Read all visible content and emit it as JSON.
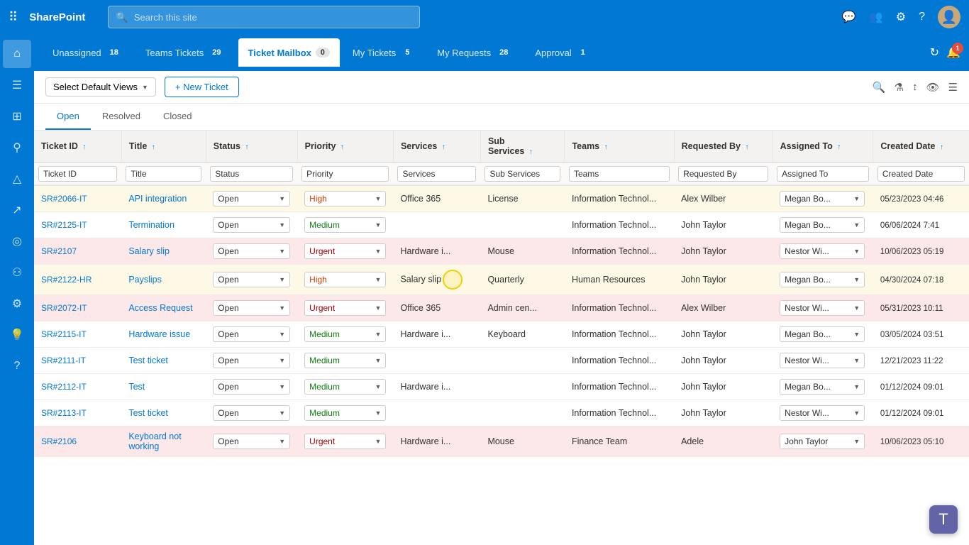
{
  "app": {
    "name": "SharePoint"
  },
  "search": {
    "placeholder": "Search this site"
  },
  "tabs": [
    {
      "id": "unassigned",
      "label": "Unassigned",
      "count": "18",
      "active": false
    },
    {
      "id": "teams-tickets",
      "label": "Teams Tickets",
      "count": "29",
      "active": false
    },
    {
      "id": "ticket-mailbox",
      "label": "Ticket Mailbox",
      "count": "0",
      "active": true
    },
    {
      "id": "my-tickets",
      "label": "My Tickets",
      "count": "5",
      "active": false
    },
    {
      "id": "my-requests",
      "label": "My Requests",
      "count": "28",
      "active": false
    },
    {
      "id": "approval",
      "label": "Approval",
      "count": "1",
      "active": false
    }
  ],
  "notification_count": "1",
  "toolbar": {
    "view_label": "Select Default Views",
    "new_ticket_label": "+ New Ticket"
  },
  "status_tabs": [
    {
      "label": "Open",
      "active": true
    },
    {
      "label": "Resolved",
      "active": false
    },
    {
      "label": "Closed",
      "active": false
    }
  ],
  "columns": [
    {
      "id": "ticket-id",
      "label": "Ticket ID",
      "sort": "↑"
    },
    {
      "id": "title",
      "label": "Title",
      "sort": "↑"
    },
    {
      "id": "status",
      "label": "Status",
      "sort": "↑"
    },
    {
      "id": "priority",
      "label": "Priority",
      "sort": "↑"
    },
    {
      "id": "services",
      "label": "Services",
      "sort": "↑"
    },
    {
      "id": "sub-services",
      "label": "Sub Services",
      "sort": "↑"
    },
    {
      "id": "teams",
      "label": "Teams",
      "sort": "↑"
    },
    {
      "id": "requested-by",
      "label": "Requested By",
      "sort": "↑"
    },
    {
      "id": "assigned-to",
      "label": "Assigned To",
      "sort": "↑"
    },
    {
      "id": "created-date",
      "label": "Created Date",
      "sort": "↑"
    }
  ],
  "filter_row": {
    "ticket_id": "Ticket ID",
    "title": "Title",
    "status": "Status",
    "priority": "Priority",
    "services": "Services",
    "sub_services": "Sub Services",
    "teams": "Teams",
    "requested_by": "Requested By",
    "assigned_to": "Assigned To",
    "created_date": "Created Date"
  },
  "rows": [
    {
      "id": "SR#2066-IT",
      "title": "API integration",
      "status": "Open",
      "priority": "High",
      "services": "Office 365",
      "sub_services": "License",
      "teams": "Information Technol...",
      "requested_by": "Alex Wilber",
      "assigned_to": "Megan Bo...",
      "created_date": "05/23/2023 04:46",
      "row_class": "row-yellow"
    },
    {
      "id": "SR#2125-IT",
      "title": "Termination",
      "status": "Open",
      "priority": "Medium",
      "services": "",
      "sub_services": "",
      "teams": "Information Technol...",
      "requested_by": "John Taylor",
      "assigned_to": "Megan Bo...",
      "created_date": "06/06/2024 7:41",
      "row_class": "row-white"
    },
    {
      "id": "SR#2107",
      "title": "Salary slip",
      "status": "Open",
      "priority": "Urgent",
      "services": "Hardware i...",
      "sub_services": "Mouse",
      "teams": "Information Technol...",
      "requested_by": "John Taylor",
      "assigned_to": "Nestor Wi...",
      "created_date": "10/06/2023 05:19",
      "row_class": "row-pink"
    },
    {
      "id": "SR#2122-HR",
      "title": "Payslips",
      "status": "Open",
      "priority": "High",
      "services": "Salary slip",
      "sub_services": "Quarterly",
      "teams": "Human Resources",
      "requested_by": "John Taylor",
      "assigned_to": "Megan Bo...",
      "created_date": "04/30/2024 07:18",
      "row_class": "row-yellow",
      "cursor": true
    },
    {
      "id": "SR#2072-IT",
      "title": "Access Request",
      "status": "Open",
      "priority": "Urgent",
      "services": "Office 365",
      "sub_services": "Admin cen...",
      "teams": "Information Technol...",
      "requested_by": "Alex Wilber",
      "assigned_to": "Nestor Wi...",
      "created_date": "05/31/2023 10:11",
      "row_class": "row-pink"
    },
    {
      "id": "SR#2115-IT",
      "title": "Hardware issue",
      "status": "Open",
      "priority": "Medium",
      "services": "Hardware i...",
      "sub_services": "Keyboard",
      "teams": "Information Technol...",
      "requested_by": "John Taylor",
      "assigned_to": "Megan Bo...",
      "created_date": "03/05/2024 03:51",
      "row_class": "row-white"
    },
    {
      "id": "SR#2111-IT",
      "title": "Test ticket",
      "status": "Open",
      "priority": "Medium",
      "services": "",
      "sub_services": "",
      "teams": "Information Technol...",
      "requested_by": "John Taylor",
      "assigned_to": "Nestor Wi...",
      "created_date": "12/21/2023 11:22",
      "row_class": "row-white"
    },
    {
      "id": "SR#2112-IT",
      "title": "Test",
      "status": "Open",
      "priority": "Medium",
      "services": "Hardware i...",
      "sub_services": "",
      "teams": "Information Technol...",
      "requested_by": "John Taylor",
      "assigned_to": "Megan Bo...",
      "created_date": "01/12/2024 09:01",
      "row_class": "row-white"
    },
    {
      "id": "SR#2113-IT",
      "title": "Test ticket",
      "status": "Open",
      "priority": "Medium",
      "services": "",
      "sub_services": "",
      "teams": "Information Technol...",
      "requested_by": "John Taylor",
      "assigned_to": "Nestor Wi...",
      "created_date": "01/12/2024 09:01",
      "row_class": "row-white"
    },
    {
      "id": "SR#2106",
      "title": "Keyboard not working",
      "status": "Open",
      "priority": "Urgent",
      "services": "Hardware i...",
      "sub_services": "Mouse",
      "teams": "Finance Team",
      "requested_by": "Adele",
      "assigned_to": "John Taylor",
      "created_date": "10/06/2023 05:10",
      "row_class": "row-pink"
    }
  ],
  "sidebar_items": [
    {
      "id": "home",
      "icon": "⌂",
      "active": true
    },
    {
      "id": "menu",
      "icon": "☰",
      "active": false
    },
    {
      "id": "dashboard",
      "icon": "⊞",
      "active": false
    },
    {
      "id": "search",
      "icon": "⚲",
      "active": false
    },
    {
      "id": "alerts",
      "icon": "△",
      "active": false
    },
    {
      "id": "analytics",
      "icon": "↗",
      "active": false
    },
    {
      "id": "connections",
      "icon": "◎",
      "active": false
    },
    {
      "id": "people",
      "icon": "⚇",
      "active": false
    },
    {
      "id": "settings",
      "icon": "⚙",
      "active": false
    },
    {
      "id": "lightbulb",
      "icon": "💡",
      "active": false
    },
    {
      "id": "help",
      "icon": "?",
      "active": false
    }
  ]
}
